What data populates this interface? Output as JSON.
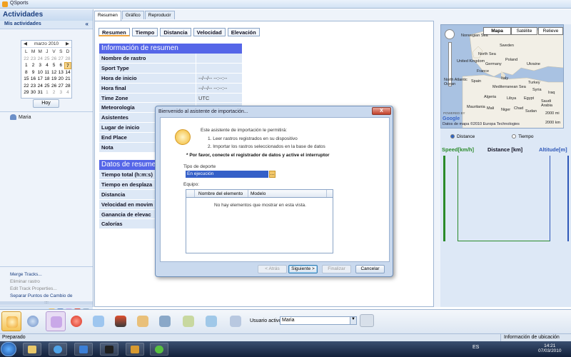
{
  "window": {
    "title": "QSports"
  },
  "sidebar": {
    "heading": "Actividades",
    "section": "Mis actividades",
    "calendar": {
      "month": "marzo 2010",
      "days_header": [
        "L",
        "M",
        "M",
        "J",
        "V",
        "S",
        "D"
      ],
      "weeks": [
        [
          "22",
          "23",
          "24",
          "25",
          "26",
          "27",
          "28"
        ],
        [
          "1",
          "2",
          "3",
          "4",
          "5",
          "6",
          "7"
        ],
        [
          "8",
          "9",
          "10",
          "11",
          "12",
          "13",
          "14"
        ],
        [
          "15",
          "16",
          "17",
          "18",
          "19",
          "20",
          "21"
        ],
        [
          "22",
          "23",
          "24",
          "25",
          "26",
          "27",
          "28"
        ],
        [
          "29",
          "30",
          "31",
          "1",
          "2",
          "3",
          "4"
        ]
      ],
      "selected_day": "7",
      "today_button": "Hoy"
    },
    "athlete": "Maria",
    "actions": [
      "Merge Tracks...",
      "Eliminar rastro",
      "Edit Track Properties...",
      "Separar Puntos de Cambio de"
    ]
  },
  "top_tabs": [
    "Resumen",
    "Gráfico",
    "Reproducir"
  ],
  "sub_tabs": [
    "Resumen",
    "Tiempo",
    "Distancia",
    "Velocidad",
    "Elevación"
  ],
  "summary": {
    "header": "Información de resumen",
    "rows": [
      {
        "k": "Nombre de rastro",
        "v": ""
      },
      {
        "k": "Sport Type",
        "v": ""
      },
      {
        "k": "Hora de inicio",
        "v": "--/--/-- --:--:--"
      },
      {
        "k": "Hora final",
        "v": "--/--/-- --:--:--"
      },
      {
        "k": "Time Zone",
        "v": "UTC"
      },
      {
        "k": "Meteorología",
        "v": ""
      },
      {
        "k": "Asistentes",
        "v": ""
      },
      {
        "k": "Lugar de inicio",
        "v": ""
      },
      {
        "k": "End Place",
        "v": ""
      },
      {
        "k": "Nota",
        "v": ""
      }
    ]
  },
  "data_summary": {
    "header": "Datos de resumen",
    "rows": [
      "Tiempo total (h:m:s)",
      "Tiempo en desplaza",
      "Distancia",
      "Velocidad en movim",
      "Ganancia de elevac",
      "Calorías"
    ]
  },
  "map": {
    "types": [
      "Mapa",
      "Satélite",
      "Relieve"
    ],
    "labels": [
      "Norwegian Sea",
      "Sweden",
      "North Sea",
      "United Kingdom",
      "Poland",
      "Germany",
      "Ukraine",
      "France",
      "North Atlantic Ocean",
      "Spain",
      "Italy",
      "Turkey",
      "Mediterranean Sea",
      "Syria",
      "Iraq",
      "Saudi Arabia",
      "Algeria",
      "Libya",
      "Egypt",
      "Mauritania",
      "Mali",
      "Niger",
      "Chad",
      "Sudan"
    ],
    "brand": "Google",
    "legal": "Datos de mapa ©2010 Europa Technologies",
    "scale_mi": "2000 mi",
    "scale_km": "2000 km",
    "overview_label": "POWERED BY"
  },
  "chart_options": {
    "distance": "Distance",
    "time": "Tiempo"
  },
  "chart_headers": {
    "speed": "Speed[km/h]",
    "distance": "Distance [km]",
    "altitude": "Altitude[m]"
  },
  "colors": {
    "speed_axis": "#2a8a2a",
    "altitude_axis": "#2f58b8",
    "accent": "#f1a640",
    "summary_header": "#5566e8"
  },
  "toolbar": {
    "user_label": "Usuario activo:",
    "user_value": "Maria",
    "icons": [
      "wizard-icon",
      "earth-icon",
      "notes-icon",
      "apple-icon",
      "hand-icon",
      "helmet-icon",
      "bag-icon",
      "satellite-icon",
      "mortar-icon",
      "chart-icon",
      "devices-icon"
    ]
  },
  "status": {
    "left": "Preparado",
    "right": "Información de ubicación"
  },
  "dialog": {
    "title": "Bienvenido al asistente de importación...",
    "close": "X",
    "intro": "Este asistente de importación le permitirá:",
    "step1": "1. Leer rastros registrados en su dispositivo",
    "step2": "2. Importar los rastros seleccionados en la base de datos",
    "warning": "* Por favor, conecte el registrador de datos y active el interruptor",
    "sport_label": "Tipo de deporte",
    "sport_value": "En ejecución",
    "equipment_label": "Equipo:",
    "col_name": "Nombre del elemento",
    "col_model": "Modelo",
    "empty": "No hay elementos que mostrar en esta vista.",
    "btn_back": "< Atrás",
    "btn_next": "Siguiente >",
    "btn_finish": "Finalizar",
    "btn_cancel": "Cancelar"
  },
  "taskbar": {
    "lang": "ES",
    "time": "14:21",
    "date": "07/03/2010"
  }
}
